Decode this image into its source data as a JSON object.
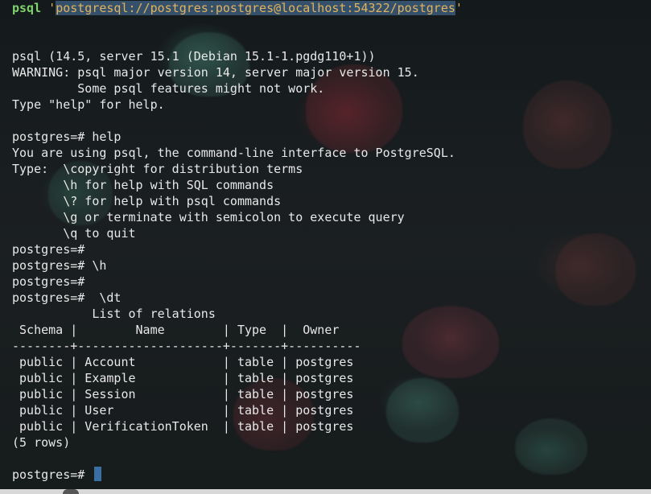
{
  "terminal": {
    "command": {
      "program": "psql",
      "open_quote": "'",
      "url": "postgresql://postgres:postgres@localhost:54322/postgres",
      "close_quote": "'"
    },
    "intro": [
      "psql (14.5, server 15.1 (Debian 15.1-1.pgdg110+1))",
      "WARNING: psql major version 14, server major version 15.",
      "         Some psql features might not work.",
      "Type \"help\" for help."
    ],
    "help_session": [
      "postgres=# help",
      "You are using psql, the command-line interface to PostgreSQL.",
      "Type:  \\copyright for distribution terms",
      "       \\h for help with SQL commands",
      "       \\? for help with psql commands",
      "       \\g or terminate with semicolon to execute query",
      "       \\q to quit",
      "postgres=#",
      "postgres=# \\h",
      "postgres=#",
      "postgres=#  \\dt"
    ],
    "relations_table": {
      "title": "           List of relations",
      "header": " Schema |        Name        | Type  |  Owner",
      "separator": "--------+--------------------+-------+----------",
      "rows": [
        " public | Account            | table | postgres",
        " public | Example            | table | postgres",
        " public | Session            | table | postgres",
        " public | User               | table | postgres",
        " public | VerificationToken  | table | postgres"
      ],
      "footer": "(5 rows)"
    },
    "prompt": "postgres=#"
  },
  "colors": {
    "command": "#7ed36b",
    "url": "#e2b35c",
    "selection": "#35506a",
    "cursor": "#3a6fa3",
    "text": "#e8e8e8"
  }
}
